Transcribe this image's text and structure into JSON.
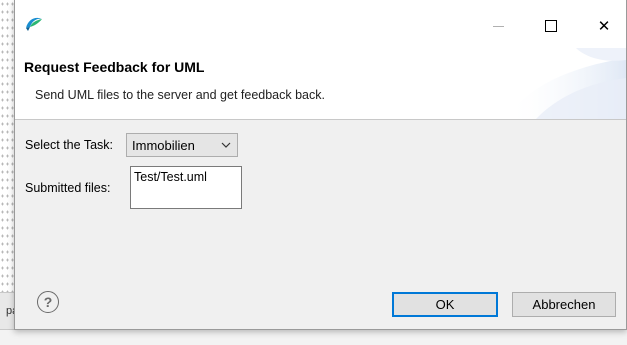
{
  "background": {
    "partial_text": "pa"
  },
  "window": {
    "min_glyph": "—",
    "close_glyph": "✕"
  },
  "header": {
    "title": "Request Feedback for UML",
    "description": "Send UML files to the server and get feedback back."
  },
  "form": {
    "task_label": "Select the Task:",
    "task_value": "Immobilien",
    "files_label": "Submitted files:",
    "files_value": "Test/Test.uml"
  },
  "footer": {
    "help_glyph": "?",
    "ok_label": "OK",
    "cancel_label": "Abbrechen"
  },
  "colors": {
    "accent": "#0078d7",
    "dialog_bg": "#f0f0f0",
    "header_bg": "#ffffff"
  }
}
